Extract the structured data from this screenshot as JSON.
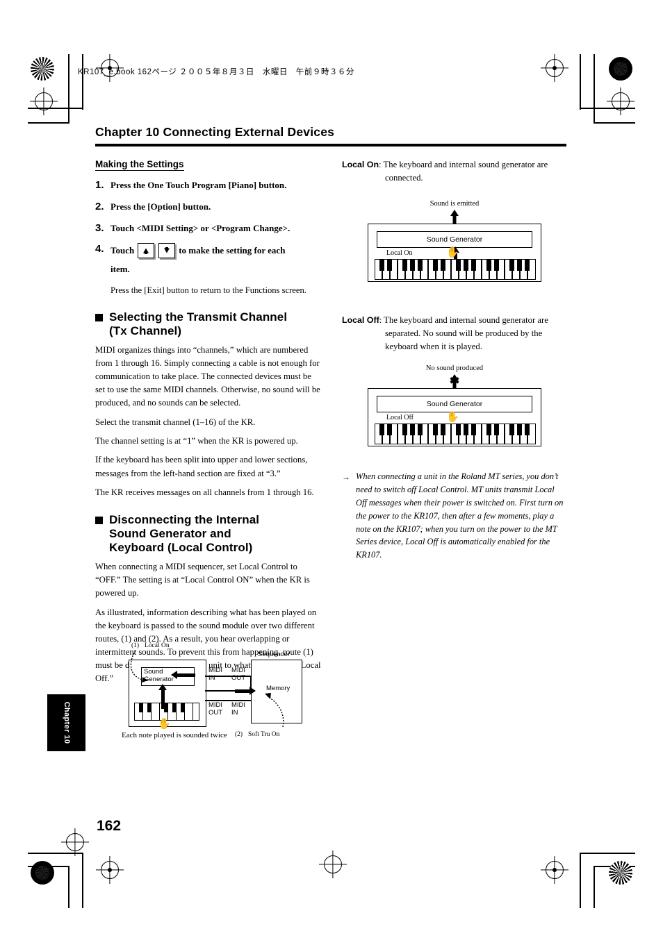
{
  "file_header": "KR107_e.book 162ページ ２００５年８月３日　水曜日　午前９時３６分",
  "chapter_title": "Chapter 10 Connecting External Devices",
  "chapter_tab": "Chapter 10",
  "page_number": "162",
  "left_column": {
    "subhead": "Making the Settings",
    "steps": [
      {
        "num": "1.",
        "text": "Press the One Touch Program [Piano] button."
      },
      {
        "num": "2.",
        "text": "Press the [Option] button."
      },
      {
        "num": "3.",
        "text": "Touch <MIDI Setting> or <Program Change>."
      },
      {
        "num": "4.",
        "text_before": "Touch",
        "text_after": "to make the setting for each",
        "text_cont": "item.",
        "icon_up": "arrow-up-button-icon",
        "icon_down": "arrow-down-button-icon",
        "sub": "Press the [Exit] button to return to the Functions screen."
      }
    ],
    "section1": {
      "heading_line1": "Selecting the Transmit Channel",
      "heading_line2": "(Tx Channel)",
      "paragraphs": [
        "MIDI organizes things into “channels,” which are numbered from 1 through 16. Simply connecting a cable is not enough for communication to take place. The connected devices must be set to use the same MIDI channels. Otherwise, no sound will be produced, and no sounds can be selected.",
        "Select the transmit channel (1–16) of the KR.",
        "The channel setting is at “1” when the KR is powered up.",
        "If the keyboard has been split into upper and lower sections, messages from the left-hand section are fixed at “3.”",
        "The KR receives messages on all channels from 1 through 16."
      ]
    },
    "section2": {
      "heading_line1": "Disconnecting the Internal",
      "heading_line2": "Sound Generator and",
      "heading_line3": "Keyboard (Local Control)",
      "paragraphs": [
        "When connecting a MIDI sequencer, set Local Control to “OFF.” The setting is at “Local Control ON” when the KR is powered up.",
        "As illustrated, information describing what has been played on the keyboard is passed to the sound module over two different routes, (1) and (2). As a result, you hear overlapping or intermittent sounds. To prevent this from happening, route (1) must be disabled, by setting the unit to what is known as “Local Off.”"
      ]
    },
    "local_diagram": {
      "label_route1": "(1)",
      "label_local_on": "Local On",
      "label_sound_generator_l1": "Sound",
      "label_sound_generator_l2": "Generator",
      "label_midi_in_l1": "MIDI",
      "label_midi_in_l2": "IN",
      "label_midi_out_top_l1": "MIDI",
      "label_midi_out_top_l2": "OUT",
      "label_midi_out_bottom_l1": "MIDI",
      "label_midi_out_bottom_l2": "OUT",
      "label_midi_in_bottom_l1": "MIDI",
      "label_midi_in_bottom_l2": "IN",
      "label_sequencer": "Sequencer",
      "label_memory": "Memory",
      "label_route2": "(2)",
      "label_soft_thru": "Soft Tru On",
      "caption": "Each note played is sounded twice"
    }
  },
  "right_column": {
    "local_on": {
      "term": "Local On",
      "definition": ": The keyboard and internal sound generator are connected.",
      "figure_caption": "Sound is emitted",
      "figure_sound_generator": "Sound Generator",
      "figure_local_label": "Local On"
    },
    "local_off": {
      "term": "Local Off",
      "definition": ": The keyboard and internal sound generator are separated. No sound will be produced by the keyboard when it is played.",
      "figure_caption": "No sound produced",
      "figure_sound_generator": "Sound Generator",
      "figure_local_label": "Local Off"
    },
    "note": "When connecting a unit in the Roland MT series, you don’t need to switch off Local Control. MT units transmit Local Off messages when their power is switched on. First turn on the power to the KR107, then after a few moments, play a note on the KR107; when you turn on the power to the MT Series device, Local Off is automatically enabled for the KR107."
  }
}
